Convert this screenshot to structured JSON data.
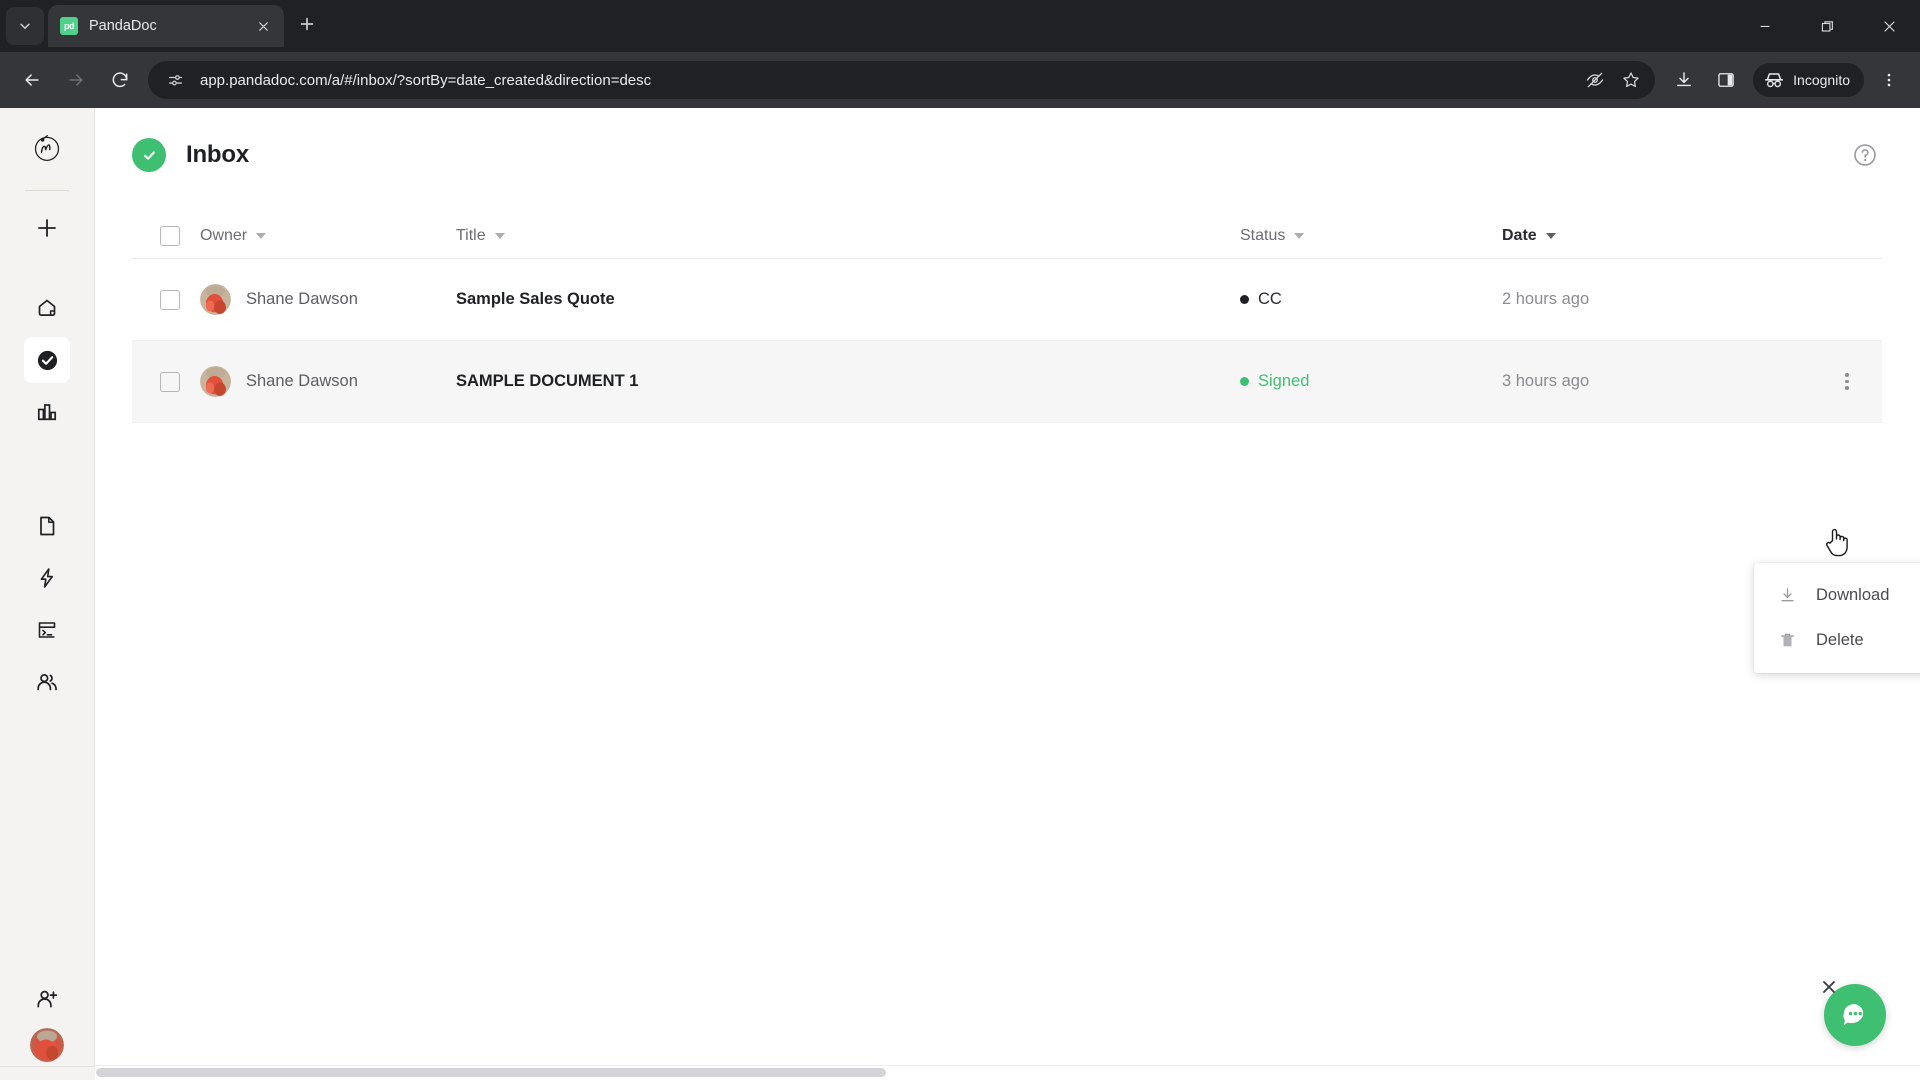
{
  "browser": {
    "tab": {
      "title": "PandaDoc",
      "favicon_text": "pd",
      "favicon_color": "#4fd18b"
    },
    "tab_search_icon": "chevron-down-icon",
    "new_tab_icon": "plus-icon",
    "window_controls": {
      "minimize": "minimize-icon",
      "maximize": "restore-icon",
      "close": "close-icon"
    },
    "nav": {
      "back_icon": "arrow-left-icon",
      "forward_icon": "arrow-right-icon",
      "reload_icon": "reload-icon"
    },
    "omnibox": {
      "url": "app.pandadoc.com/a/#/inbox/?sortBy=date_created&direction=desc",
      "site_info_icon": "tune-icon",
      "tracking_icon": "eye-off-icon",
      "bookmark_icon": "star-icon"
    },
    "toolbar": {
      "download_icon": "download-icon",
      "side_panel_icon": "side-panel-icon",
      "incognito_label": "Incognito",
      "incognito_icon": "incognito-icon",
      "menu_icon": "kebab-menu-icon"
    }
  },
  "app": {
    "sidebar": {
      "logo": "pandadoc-logo",
      "items": [
        {
          "name": "create-new",
          "icon": "plus-icon",
          "active": false
        },
        {
          "name": "home",
          "icon": "home-icon",
          "active": false
        },
        {
          "name": "inbox",
          "icon": "check-circle-icon",
          "active": true
        },
        {
          "name": "reports",
          "icon": "bar-chart-icon",
          "active": false
        },
        {
          "name": "documents",
          "icon": "document-icon",
          "active": false
        },
        {
          "name": "quick-actions",
          "icon": "lightning-icon",
          "active": false
        },
        {
          "name": "forms",
          "icon": "form-icon",
          "active": false
        },
        {
          "name": "contacts",
          "icon": "people-icon",
          "active": false
        }
      ],
      "invite_icon": "add-user-icon",
      "avatar": "user-avatar"
    },
    "header": {
      "title": "Inbox",
      "icon": "check-circle-icon",
      "icon_color": "#3fbf72",
      "help_icon": "help-circle-icon"
    },
    "table": {
      "select_all": {
        "checked": false
      },
      "columns": [
        {
          "key": "owner",
          "label": "Owner",
          "sortable": true
        },
        {
          "key": "title",
          "label": "Title",
          "sortable": true
        },
        {
          "key": "status",
          "label": "Status",
          "sortable": true
        },
        {
          "key": "date",
          "label": "Date",
          "sortable": true
        }
      ],
      "rows": [
        {
          "checked": false,
          "owner": "Shane Dawson",
          "title": "Sample Sales Quote",
          "status": "CC",
          "status_color": "#1f2024",
          "date": "2 hours ago",
          "highlighted": false
        },
        {
          "checked": false,
          "owner": "Shane Dawson",
          "title": "SAMPLE DOCUMENT 1",
          "status": "Signed",
          "status_color": "#3fbf72",
          "date": "3 hours ago",
          "highlighted": true
        }
      ]
    },
    "context_menu": {
      "visible": true,
      "items": [
        {
          "label": "Download",
          "icon": "download-icon"
        },
        {
          "label": "Delete",
          "icon": "trash-icon"
        }
      ]
    },
    "chat_widget": {
      "icon": "chat-bubble-icon",
      "color": "#3fbf72",
      "close_icon": "close-icon"
    }
  }
}
